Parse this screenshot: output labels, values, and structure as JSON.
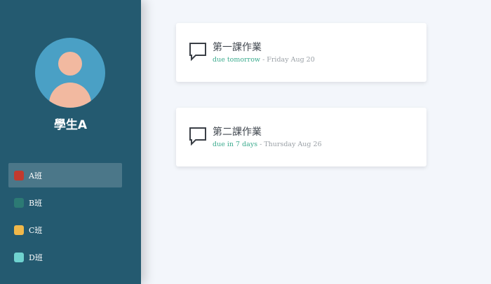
{
  "user": {
    "name": "學生A"
  },
  "nav": {
    "items": [
      {
        "label": "A班",
        "color": "#c23a2e",
        "active": true
      },
      {
        "label": "B班",
        "color": "#2c7a74",
        "active": false
      },
      {
        "label": "C班",
        "color": "#f0b84a",
        "active": false
      },
      {
        "label": "D班",
        "color": "#6fd2cf",
        "active": false
      }
    ]
  },
  "assignments": [
    {
      "title": "第一課作業",
      "due": "due tomorrow",
      "separator": " - ",
      "date": "Friday Aug 20"
    },
    {
      "title": "第二課作業",
      "due": "due in 7 days",
      "separator": " - ",
      "date": "Thursday Aug 26"
    }
  ],
  "colors": {
    "sidebar": "#245a70",
    "accent_due": "#3cab8e",
    "avatar_bg": "#4aa0c5",
    "skin": "#f2b9a0"
  }
}
